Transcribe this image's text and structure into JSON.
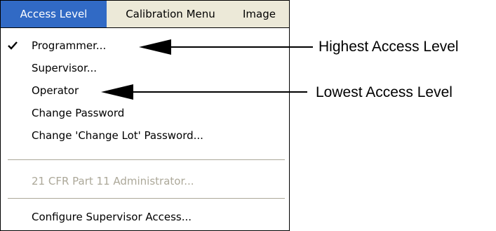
{
  "menubar": {
    "items": [
      {
        "label": "Access Level",
        "active": true
      },
      {
        "label": "Calibration Menu",
        "active": false
      },
      {
        "label": "Image",
        "active": false
      }
    ]
  },
  "menu": {
    "items": [
      {
        "label": "Programmer...",
        "checked": true,
        "enabled": true
      },
      {
        "label": "Supervisor...",
        "checked": false,
        "enabled": true
      },
      {
        "label": "Operator",
        "checked": false,
        "enabled": true
      },
      {
        "label": "Change Password",
        "checked": false,
        "enabled": true
      },
      {
        "label": "Change 'Change Lot' Password...",
        "checked": false,
        "enabled": true
      },
      {
        "label": "21 CFR Part 11 Administrator...",
        "checked": false,
        "enabled": false
      },
      {
        "label": "Configure Supervisor Access...",
        "checked": false,
        "enabled": true
      }
    ]
  },
  "annotations": {
    "highest": "Highest Access Level",
    "lowest": "Lowest Access Level"
  },
  "icons": {
    "check": "checkmark-icon"
  },
  "colors": {
    "highlight": "#316ac5",
    "menubar_bg": "#ece9d8",
    "disabled_text": "#aca899"
  }
}
